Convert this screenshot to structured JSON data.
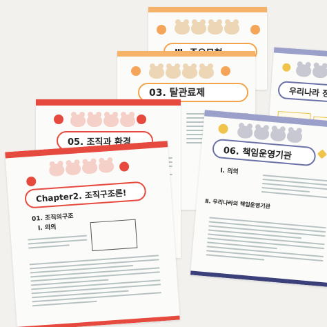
{
  "sheets": {
    "s1": {
      "title": "Ⅲ. 주요모형"
    },
    "s2": {
      "title": "03. 탈관료제"
    },
    "s3": {
      "title": "우리나라 정부"
    },
    "s4": {
      "title": "05. 조직과 환경"
    },
    "s5": {
      "title": "06. 책임운영기관",
      "subhead1": "Ⅰ. 의의",
      "subhead2": "Ⅱ. 우리나라의 책임운영기관"
    },
    "s6": {
      "title": "Chapter2. 조직구조론!",
      "subhead1": "01. 조직의구조",
      "subhead2": "Ⅰ. 의의"
    }
  },
  "colors": {
    "paper": "#fbfbf9",
    "red_band": "#e64a3e",
    "orange_band": "#f5b36a",
    "lavender_band": "#9aa0c9",
    "navy_band": "#3b3f7a"
  }
}
